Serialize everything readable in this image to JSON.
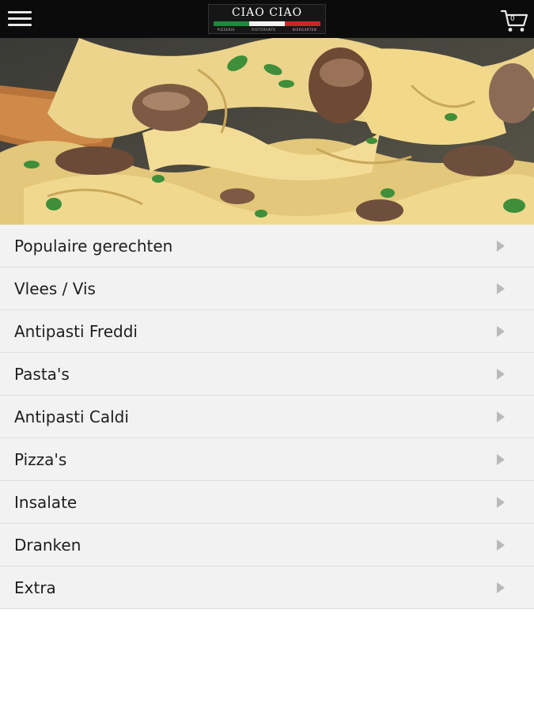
{
  "header": {
    "menu_icon": "hamburger-menu-icon",
    "logo": {
      "name": "CIAO CIAO",
      "subtitles": [
        "PIZZERIA",
        "RISTORANTE",
        "BIERGARTEN"
      ],
      "flag_colors": [
        "#1f8a3a",
        "#f2f2f2",
        "#c62828"
      ]
    },
    "cart": {
      "icon": "shopping-cart-icon",
      "count": "0"
    }
  },
  "hero": {
    "alt": "pasta-with-mushrooms-photo"
  },
  "menu": {
    "arrow_icon": "chevron-right-icon",
    "items": [
      {
        "label": "Populaire gerechten"
      },
      {
        "label": "Vlees / Vis"
      },
      {
        "label": "Antipasti Freddi"
      },
      {
        "label": "Pasta's"
      },
      {
        "label": "Antipasti Caldi"
      },
      {
        "label": "Pizza's"
      },
      {
        "label": "Insalate"
      },
      {
        "label": "Dranken"
      },
      {
        "label": "Extra"
      }
    ]
  },
  "colors": {
    "header_bg": "#0b0b0b",
    "row_bg": "#f2f2f2",
    "row_border": "#dedede",
    "arrow": "#b9b9b9",
    "text": "#1e1e1e"
  }
}
